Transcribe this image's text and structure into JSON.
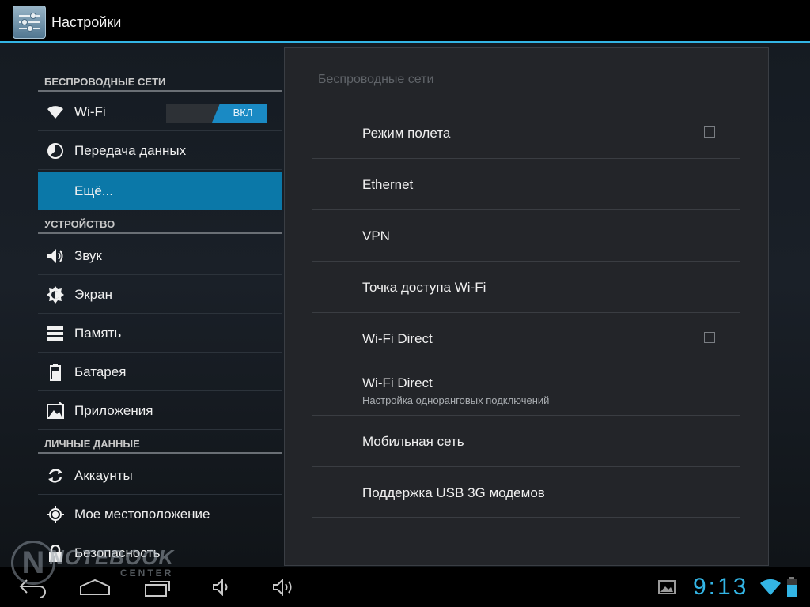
{
  "app": {
    "title": "Настройки",
    "icon": "settings-sliders-icon",
    "accent": "#33b5e5"
  },
  "sidebar": {
    "headers": {
      "wireless": "БЕСПРОВОДНЫЕ СЕТИ",
      "device": "УСТРОЙСТВО",
      "personal": "ЛИЧНЫЕ ДАННЫЕ"
    },
    "items": [
      {
        "label": "Wi-Fi",
        "icon": "wifi-icon",
        "toggle": "ВКЛ"
      },
      {
        "label": "Передача данных",
        "icon": "data-usage-icon"
      },
      {
        "label": "Ещё...",
        "active": true
      },
      {
        "label": "Звук",
        "icon": "speaker-icon"
      },
      {
        "label": "Экран",
        "icon": "brightness-icon"
      },
      {
        "label": "Память",
        "icon": "storage-icon"
      },
      {
        "label": "Батарея",
        "icon": "battery-icon"
      },
      {
        "label": "Приложения",
        "icon": "apps-icon"
      },
      {
        "label": "Аккаунты",
        "icon": "sync-icon"
      },
      {
        "label": "Мое местоположение",
        "icon": "location-icon"
      },
      {
        "label": "Безопасность",
        "icon": "lock-icon"
      }
    ]
  },
  "panel": {
    "title": "Беспроводные сети",
    "rows": [
      {
        "title": "Режим полета",
        "checkbox": true,
        "checked": false
      },
      {
        "title": "Ethernet"
      },
      {
        "title": "VPN"
      },
      {
        "title": "Точка доступа Wi-Fi"
      },
      {
        "title": "Wi-Fi Direct",
        "checkbox": true,
        "checked": false
      },
      {
        "title": "Wi-Fi Direct",
        "subtitle": "Настройка одноранговых подключений"
      },
      {
        "title": "Мобильная сеть"
      },
      {
        "title": "Поддержка USB 3G модемов"
      }
    ]
  },
  "navbar": {
    "clock": "9:13",
    "buttons": [
      "back-icon",
      "home-icon",
      "recent-apps-icon",
      "volume-down-icon",
      "volume-up-icon"
    ],
    "status_icons": [
      "gallery-icon",
      "wifi-status-icon",
      "battery-status-icon"
    ]
  },
  "watermark": {
    "main": "NOTEBOOK",
    "sub": "CENTER"
  }
}
